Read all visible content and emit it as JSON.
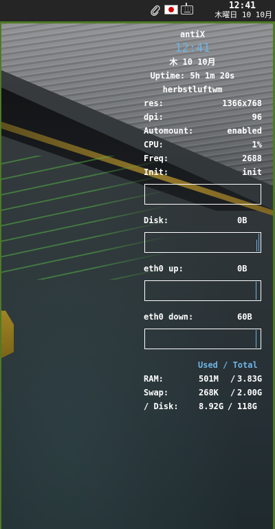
{
  "panel": {
    "clock_time": "12:41",
    "clock_date": "木曜日 10 10月",
    "tray": {
      "clip_icon": "paperclip-icon",
      "flag_icon": "japan-flag-icon",
      "keyboard_icon": "keyboard-icon"
    }
  },
  "conky": {
    "os": "antiX",
    "time": "12:41",
    "date": "木 10 10月",
    "uptime": "Uptime: 5h 1m 20s",
    "wm": "herbstluftwm",
    "rows": {
      "res": {
        "label": "res:",
        "value": "1366x768"
      },
      "dpi": {
        "label": "dpi:",
        "value": "96"
      },
      "automount": {
        "label": "Automount:",
        "value": "enabled"
      },
      "cpu": {
        "label": "CPU:",
        "value": "1%"
      },
      "freq": {
        "label": "Freq:",
        "value": "2688"
      },
      "init": {
        "label": "Init:",
        "value": "init"
      }
    },
    "disk": {
      "label": "Disk:",
      "value": "0B"
    },
    "eth_up": {
      "label": "eth0 up:",
      "value": "0B"
    },
    "eth_down": {
      "label": "eth0 down:",
      "value": "60B"
    },
    "mem_header": "Used / Total",
    "ram": {
      "label": "RAM:",
      "used": "501M",
      "sep": "/",
      "total": "3.83G"
    },
    "swap": {
      "label": "Swap:",
      "used": "268K",
      "sep": "/",
      "total": "2.00G"
    },
    "rootdisk": {
      "label": "/ Disk:",
      "used": "8.92G",
      "sep": "/",
      "total": "118G"
    }
  },
  "colors": {
    "accent": "#6fb4e6",
    "frame": "#4f7a25",
    "panel": "#252525"
  }
}
